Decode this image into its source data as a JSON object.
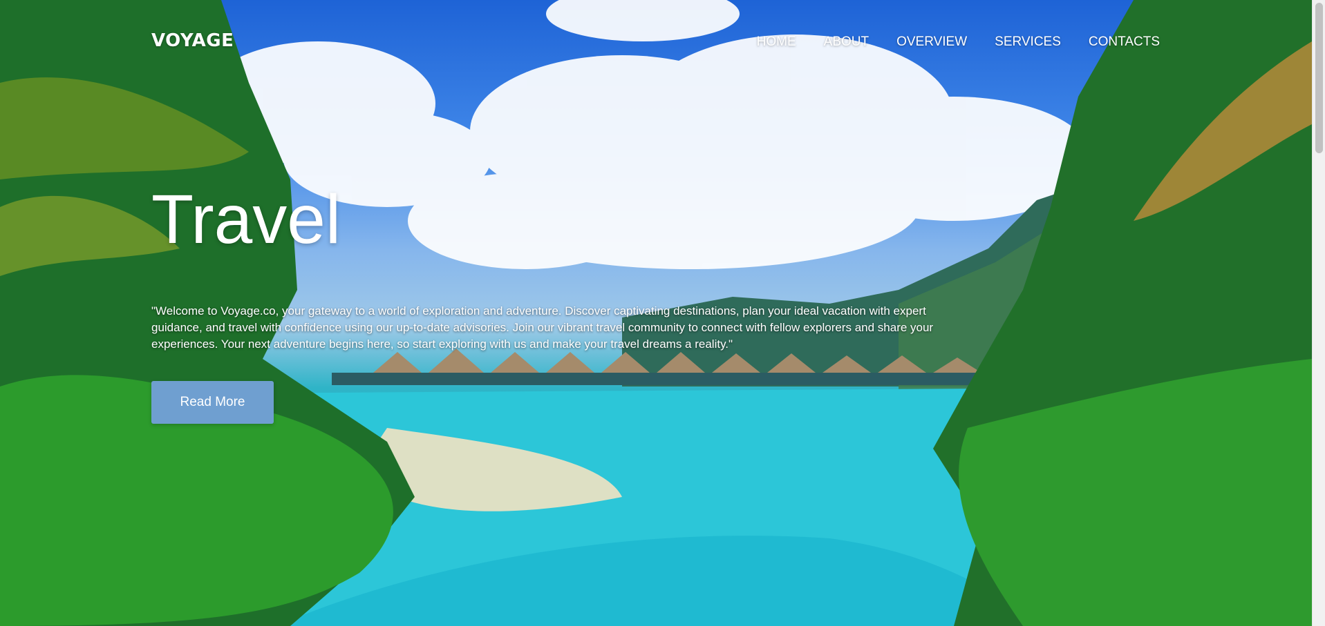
{
  "brand": {
    "name": "VOYAGE"
  },
  "nav": {
    "items": [
      {
        "label": "HOME"
      },
      {
        "label": "ABOUT"
      },
      {
        "label": "OVERVIEW"
      },
      {
        "label": "SERVICES"
      },
      {
        "label": "CONTACTS"
      }
    ]
  },
  "hero": {
    "title": "Travel",
    "description": "\"Welcome to Voyage.co, your gateway to a world of exploration and adventure. Discover captivating destinations, plan your ideal vacation with expert guidance, and travel with confidence using our up-to-date advisories. Join our vibrant travel community to connect with fellow explorers and share your experiences. Your next adventure begins here, so start exploring with us and make your travel dreams a reality.\"",
    "button_label": "Read More"
  },
  "colors": {
    "button": "#6f9fd0",
    "text": "#ffffff"
  }
}
